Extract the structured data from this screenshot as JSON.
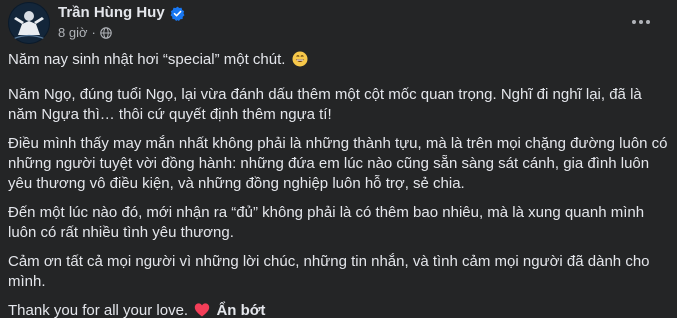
{
  "author": {
    "name": "Trần Hùng Huy",
    "time": "8 giờ"
  },
  "menu": {
    "more_label": "···"
  },
  "paragraphs": [
    "Năm nay sinh nhật hơi “special” một chút.",
    "Năm Ngọ, đúng tuổi Ngọ, lại vừa đánh dấu thêm một cột mốc quan trọng. Nghĩ đi nghĩ lại, đã là năm Ngựa thì… thôi cứ quyết định thêm ngựa tí!",
    "Điều mình thấy may mắn nhất không phải là những thành tựu, mà là trên mọi chặng đường luôn có những người tuyệt vời đồng hành: những đứa em lúc nào cũng sẵn sàng sát cánh, gia đình luôn yêu thương vô điều kiện, và những đồng nghiệp luôn hỗ trợ, sẻ chia.",
    "Đến một lúc nào đó, mới nhận ra “đủ” không phải là có thêm bao nhiêu, mà là xung quanh mình luôn có rất nhiều tình yêu thương.",
    "Cảm ơn tất cả mọi người vì những lời chúc, những tin nhắn, và tình cảm mọi người đã dành cho mình.",
    "Thank you for all your love."
  ],
  "see_less_label": "Ẩn bớt",
  "colors": {
    "background": "#242526",
    "text": "#e4e6eb",
    "secondary_text": "#b0b3b8",
    "verified": "#1877f2",
    "heart": "#f33e58"
  },
  "icons": {
    "verified": "verified-badge-icon",
    "privacy": "globe-icon",
    "smile": "grinning-emoji-icon",
    "heart": "red-heart-emoji-icon",
    "more": "more-options-icon"
  }
}
